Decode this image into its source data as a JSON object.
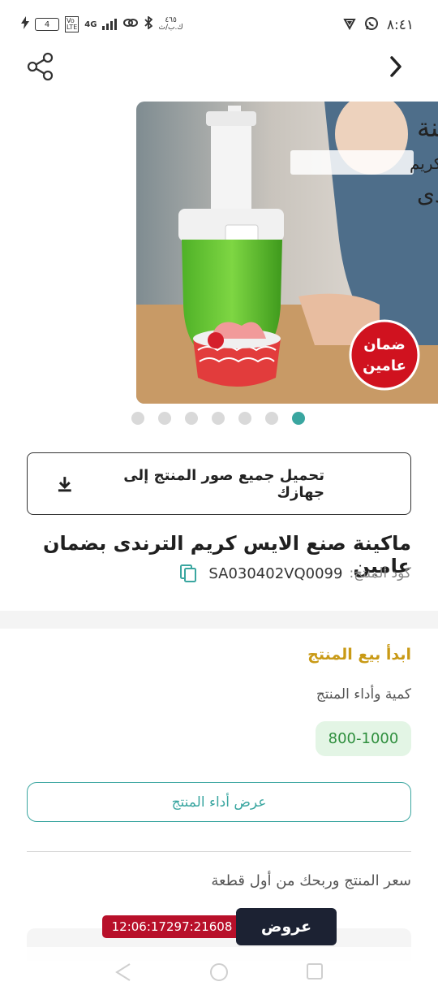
{
  "status_bar": {
    "time": "٨:٤١",
    "battery": "4",
    "network_speed_value": "٤٦٥",
    "network_speed_unit": "ك.ب/ث",
    "network_type": "4G"
  },
  "header": {
    "back_icon": "chevron-right-icon",
    "share_icon": "share-icon"
  },
  "product_image": {
    "title_line1": "ماكينة",
    "title_line2": "صنع الايس كريم",
    "title_line3": "الترندى",
    "badge_line1": "ضمان",
    "badge_line2": "عامين",
    "badge_color": "#d0121f"
  },
  "carousel": {
    "count": 7,
    "active_index": 6,
    "active_color": "#3aa6a0"
  },
  "download": {
    "label": "تحميل جميع صور المنتج إلى جهازك",
    "icon": "download-icon"
  },
  "product": {
    "title": "ماكينة صنع الايس كريم الترندى بضمان عامين",
    "code_label": "كود المنتج:",
    "code_value": "SA030402VQ0099",
    "copy_icon": "copy-icon"
  },
  "selling": {
    "heading": "ابدأ بيع المنتج",
    "quantity_label": "كمية وأداء المنتج",
    "quantity_range": "800-1000",
    "performance_button": "عرض أداء المنتج",
    "price_label": "سعر المنتج وربحك من أول قطعة",
    "accent_color": "#c99a16"
  },
  "footer": {
    "timer": "12:06:17297:21608",
    "offers_button": "عروض"
  },
  "nav": {
    "back_icon": "triangle-back-icon",
    "home_icon": "circle-home-icon",
    "recents_icon": "square-recents-icon"
  }
}
